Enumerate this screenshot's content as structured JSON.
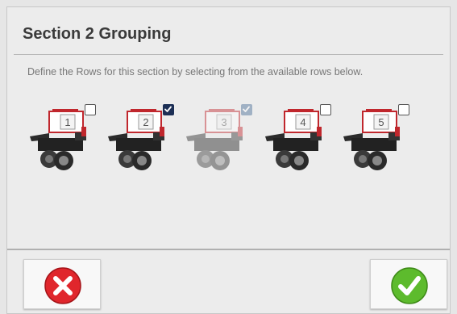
{
  "dialog": {
    "title": "Section 2 Grouping",
    "instructions": "Define the Rows for this section by selecting from the available rows below."
  },
  "rows": [
    {
      "label": "1",
      "checked": false,
      "disabled": false
    },
    {
      "label": "2",
      "checked": true,
      "disabled": false
    },
    {
      "label": "3",
      "checked": true,
      "disabled": true
    },
    {
      "label": "4",
      "checked": false,
      "disabled": false
    },
    {
      "label": "5",
      "checked": false,
      "disabled": false
    }
  ],
  "buttons": {
    "cancel_icon": "red-x-icon",
    "ok_icon": "green-check-icon"
  },
  "colors": {
    "accent_red": "#c0272d",
    "checkbox_checked": "#1c2f55",
    "checkbox_disabled_checked": "#456a95",
    "cancel_red": "#e0262c",
    "ok_green": "#5dbb2d"
  }
}
